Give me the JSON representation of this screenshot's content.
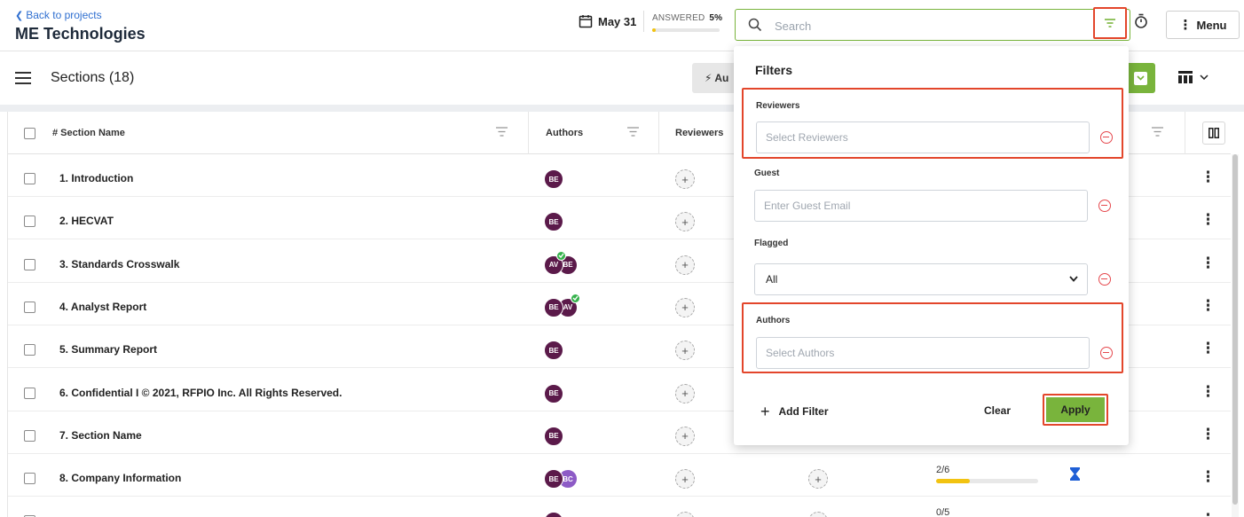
{
  "header": {
    "back_label": "Back to projects",
    "project_name": "ME Technologies",
    "due_date": "May 31",
    "answered_label": "ANSWERED",
    "answered_value": "5%",
    "answered_fraction": 0.05,
    "search_placeholder": "Search",
    "menu_label": "Menu"
  },
  "sections_bar": {
    "title": "Sections (18)",
    "auto_button_label": "Au"
  },
  "table": {
    "columns": {
      "name": "# Section Name",
      "authors": "Authors",
      "reviewers": "Reviewers"
    },
    "rows": [
      {
        "name": "1. Introduction",
        "authors": [
          {
            "initials": "BE"
          }
        ]
      },
      {
        "name": "2. HECVAT",
        "authors": [
          {
            "initials": "BE"
          }
        ]
      },
      {
        "name": "3. Standards Crosswalk",
        "authors": [
          {
            "initials": "AV",
            "check": true
          },
          {
            "initials": "BE"
          }
        ]
      },
      {
        "name": "4. Analyst Report",
        "authors": [
          {
            "initials": "BE"
          },
          {
            "initials": "AV",
            "check": true
          }
        ]
      },
      {
        "name": "5. Summary Report",
        "authors": [
          {
            "initials": "BE"
          }
        ]
      },
      {
        "name": "6. Confidential I © 2021, RFPIO Inc. All Rights Reserved.",
        "authors": [
          {
            "initials": "BE"
          }
        ]
      },
      {
        "name": "7. Section Name",
        "authors": [
          {
            "initials": "BE"
          }
        ]
      },
      {
        "name": "8. Company Information",
        "authors": [
          {
            "initials": "BE"
          },
          {
            "initials": "BC",
            "purple": true
          }
        ],
        "progress_text": "2/6",
        "progress_fraction": 0.333
      },
      {
        "name": "",
        "authors": [
          {
            "initials": ""
          }
        ],
        "progress_text": "0/5"
      }
    ]
  },
  "filters": {
    "title": "Filters",
    "reviewers_label": "Reviewers",
    "reviewers_placeholder": "Select Reviewers",
    "guest_label": "Guest",
    "guest_placeholder": "Enter Guest Email",
    "flagged_label": "Flagged",
    "flagged_value": "All",
    "authors_label": "Authors",
    "authors_placeholder": "Select Authors",
    "add_filter_label": "Add Filter",
    "clear_label": "Clear",
    "apply_label": "Apply"
  },
  "colors": {
    "accent_green": "#79b43c",
    "highlight_red": "#e3462b",
    "avatar_dark": "#5b1a4a",
    "avatar_purple": "#8d5bc6",
    "progress_yellow": "#f2c311",
    "link_blue": "#2f6fd0"
  },
  "icons": [
    "chevron-left-icon",
    "calendar-icon",
    "search-icon",
    "filter-icon",
    "timer-icon",
    "kebab-icon",
    "hamburger-icon",
    "lightning-icon",
    "chevron-down-icon",
    "table-view-icon",
    "column-toggle-icon",
    "plus-icon",
    "remove-circle-icon",
    "hourglass-icon",
    "check-icon"
  ]
}
